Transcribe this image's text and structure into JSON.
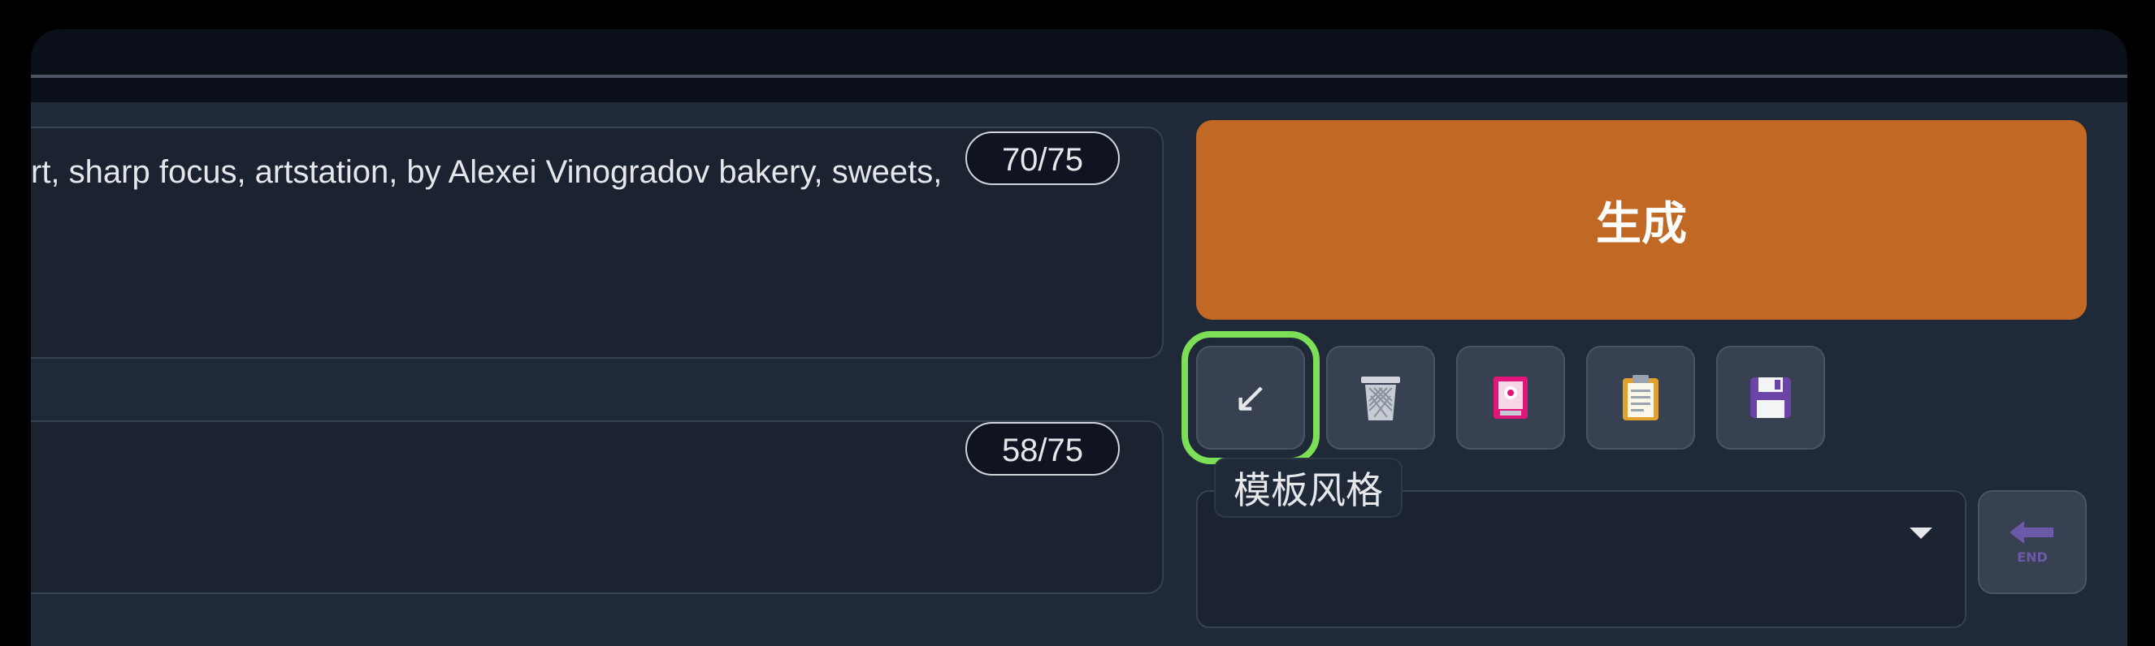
{
  "prompt": {
    "text": "rt, sharp focus, artstation, by Alexei Vinogradov bakery, sweets,",
    "token_counter": "70/75"
  },
  "negative_prompt": {
    "text": "",
    "token_counter": "58/75"
  },
  "generate_button": {
    "label": "生成"
  },
  "tools": [
    {
      "name": "read-params",
      "icon": "arrow-down-left-icon"
    },
    {
      "name": "clear",
      "icon": "wastebasket-icon"
    },
    {
      "name": "extra-networks",
      "icon": "image-card-icon"
    },
    {
      "name": "apply-style",
      "icon": "clipboard-icon"
    },
    {
      "name": "save-style",
      "icon": "floppy-disk-icon"
    }
  ],
  "style_selector": {
    "label": "模板风格",
    "value": ""
  },
  "end_button": {
    "label": "END"
  },
  "colors": {
    "generate_bg": "#c16824",
    "highlight": "#7ddf57",
    "panel_bg": "#1f2937"
  }
}
